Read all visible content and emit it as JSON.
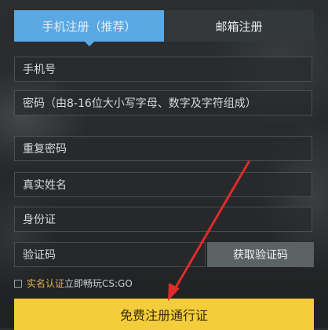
{
  "tabs": {
    "phone_label": "手机注册（推荐）",
    "email_label": "邮箱注册"
  },
  "form": {
    "phone_placeholder": "手机号",
    "password_placeholder": "密码（由8-16位大小写字母、数字及字符组成）",
    "confirm_password_placeholder": "重复密码",
    "real_name_placeholder": "真实姓名",
    "id_card_placeholder": "身份证",
    "verification_code_placeholder": "验证码",
    "get_code_label": "获取验证码"
  },
  "agreement": {
    "link_label": "实名认证",
    "text": "立即畅玩CS:GO"
  },
  "submit_label": "免费注册通行证",
  "colors": {
    "tab_active": "#5aa9e4",
    "submit_button": "#f3cd3b",
    "arrow": "#e02b2b"
  }
}
